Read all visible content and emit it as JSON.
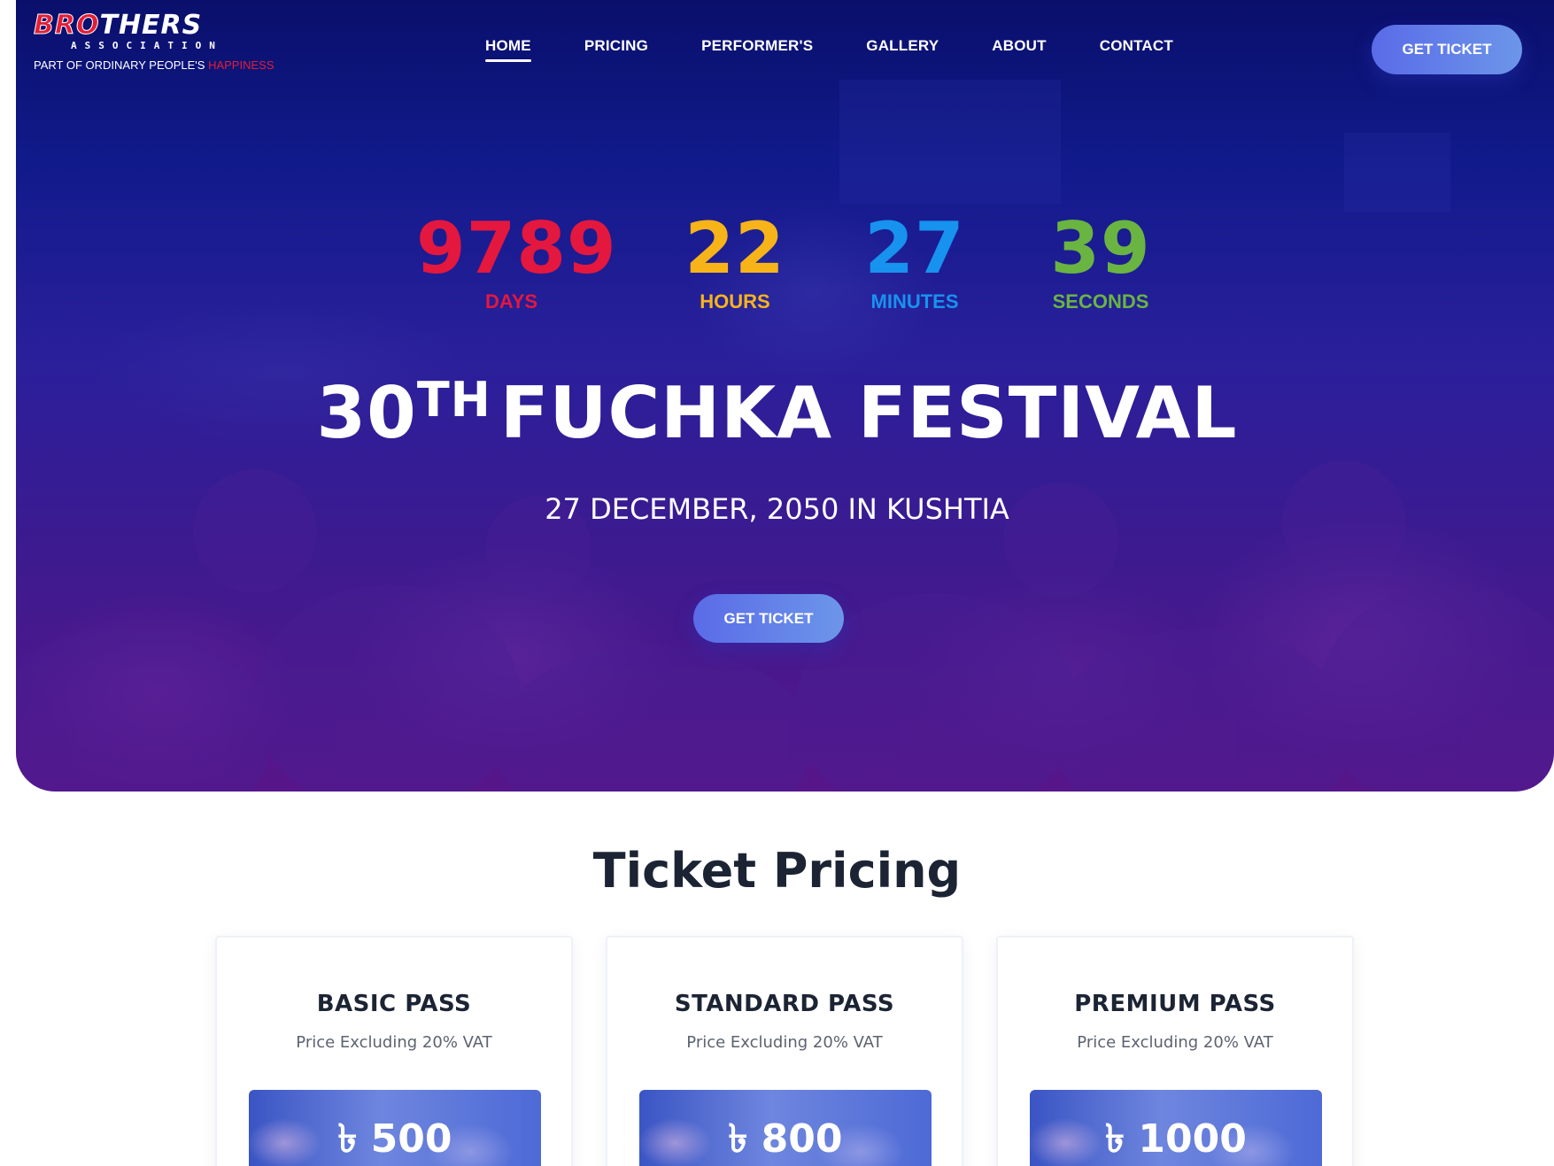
{
  "brand": {
    "logo_part1": "BRO",
    "logo_part2": "THERS",
    "logo_sub": "ASSOCIATION",
    "tagline": "PART OF ORDINARY PEOPLE'S",
    "tagline_accent": "HAPPINESS"
  },
  "nav": {
    "items": [
      {
        "label": "HOME",
        "active": true
      },
      {
        "label": "PRICING",
        "active": false
      },
      {
        "label": "PERFORMER'S",
        "active": false
      },
      {
        "label": "GALLERY",
        "active": false
      },
      {
        "label": "ABOUT",
        "active": false
      },
      {
        "label": "CONTACT",
        "active": false
      }
    ],
    "cta_label": "GET TICKET"
  },
  "hero": {
    "countdown": [
      {
        "value": "9789",
        "label": "DAYS",
        "color": "#e4173f"
      },
      {
        "value": "22",
        "label": "HOURS",
        "color": "#f7b419"
      },
      {
        "value": "27",
        "label": "MINUTES",
        "color": "#1792ef"
      },
      {
        "value": "39",
        "label": "SECONDS",
        "color": "#6ab441"
      }
    ],
    "title_number": "30",
    "title_suffix": "TH",
    "title_text": "FUCHKA FESTIVAL",
    "subtitle": "27 DECEMBER, 2050 IN KUSHTIA",
    "cta_label": "GET TICKET"
  },
  "pricing": {
    "title": "Ticket Pricing",
    "cards": [
      {
        "name": "BASIC PASS",
        "description": "Price Excluding 20% VAT",
        "price": "৳ 500"
      },
      {
        "name": "STANDARD PASS",
        "description": "Price Excluding 20% VAT",
        "price": "৳ 800"
      },
      {
        "name": "PREMIUM PASS",
        "description": "Price Excluding 20% VAT",
        "price": "৳ 1000"
      }
    ]
  },
  "colors": {
    "accent_red": "#e21d36",
    "button_blue": "#5a6be8",
    "hero_dark": "#0a0f6b",
    "hero_purple": "#57168a"
  }
}
